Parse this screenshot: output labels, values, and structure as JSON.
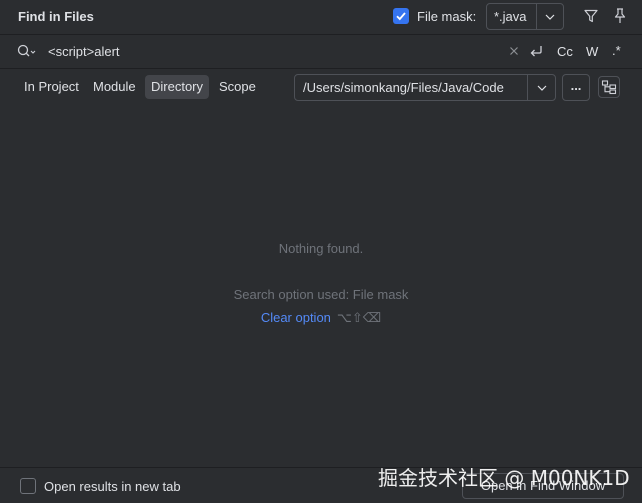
{
  "header": {
    "title": "Find in Files",
    "file_mask_label": "File mask:",
    "file_mask_checked": true,
    "file_mask_value": "*.java",
    "filter_icon": "filter-icon",
    "pin_icon": "pin-icon"
  },
  "search": {
    "query": "<script>alert",
    "options": {
      "match_case": "Cc",
      "words": "W",
      "regex": ".*"
    },
    "icons": [
      "search-history-icon",
      "clear-icon",
      "new-line-icon"
    ]
  },
  "scope": {
    "tabs": [
      {
        "label": "In Project",
        "active": false
      },
      {
        "label": "Module",
        "active": false
      },
      {
        "label": "Directory",
        "active": true
      },
      {
        "label": "Scope",
        "active": false
      }
    ],
    "directory": "/Users/simonkang/Files/Java/Code",
    "browse_label": "..."
  },
  "results": {
    "empty_text": "Nothing found.",
    "search_option_text": "Search option used: File mask",
    "clear_option_label": "Clear option",
    "clear_shortcut": "⌥⇧⌫"
  },
  "footer": {
    "new_tab_label": "Open results in new tab",
    "new_tab_checked": false,
    "open_find_window_label": "Open in Find Window"
  },
  "watermark": "掘金技术社区 @ M00NK1D",
  "colors": {
    "background": "#2b2d30",
    "accent": "#3574f0",
    "link": "#548af7",
    "muted": "#6f737a"
  }
}
